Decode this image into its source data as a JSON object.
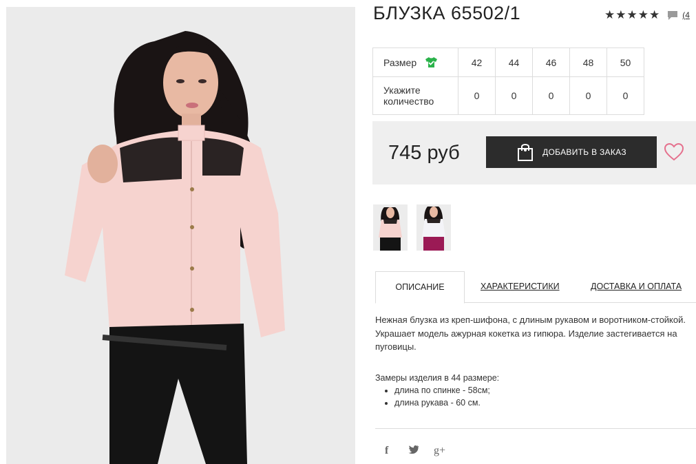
{
  "product": {
    "title": "БЛУЗКА 65502/1",
    "stars": "★★★★★",
    "review_count": "(4"
  },
  "sizes": {
    "size_label": "Размер",
    "qty_label_line1": "Укажите",
    "qty_label_line2": "количество",
    "columns": [
      "42",
      "44",
      "46",
      "48",
      "50"
    ],
    "quantities": [
      "0",
      "0",
      "0",
      "0",
      "0"
    ]
  },
  "purchase": {
    "price": "745 руб",
    "order_button": "ДОБАВИТЬ В ЗАКАЗ"
  },
  "tabs": {
    "description": "ОПИСАНИЕ",
    "characteristics": "ХАРАКТЕРИСТИКИ",
    "delivery": "ДОСТАВКА И ОПЛАТА"
  },
  "description": {
    "text": "Нежная блузка из креп-шифона, с длиным рукавом и воротником-стойкой. Украшает модель ажурная кокетка из гипюра. Изделие застегивается на пуговицы.",
    "measures_title": "Замеры изделия в 44 размере:",
    "measures": [
      "длина по спинке - 58см;",
      "длина рукава - 60 см."
    ]
  },
  "social": {
    "facebook": "f",
    "twitter": "t",
    "googleplus": "g+"
  },
  "colors": {
    "button_bg": "#2c2c2c",
    "price_bg": "#efefef",
    "heart": "#e5708d",
    "size_icon": "#2ab24a"
  },
  "icons": [
    "comment-icon",
    "size-tshirt-icon",
    "shopping-bag-icon",
    "heart-icon",
    "facebook-icon",
    "twitter-icon",
    "google-plus-icon"
  ]
}
